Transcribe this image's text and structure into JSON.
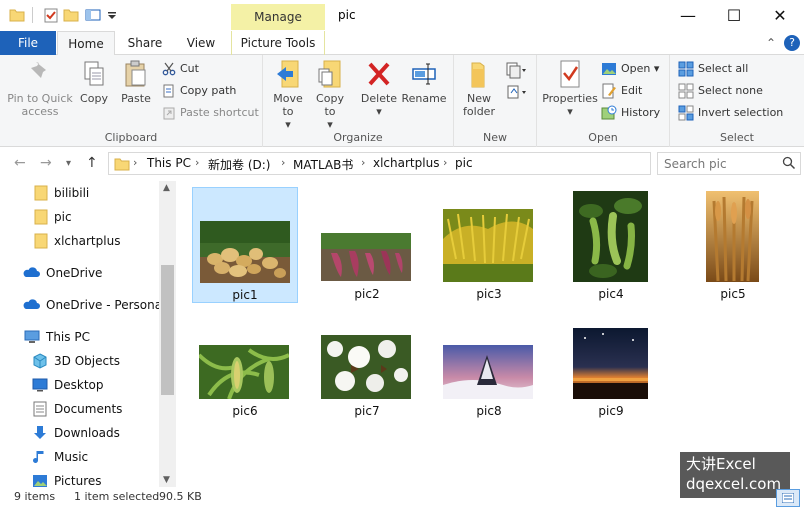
{
  "window": {
    "title": "pic",
    "context_tab": "Manage",
    "minimize": "—",
    "maximize": "☐",
    "close": "✕"
  },
  "tabs": {
    "file": "File",
    "home": "Home",
    "share": "Share",
    "view": "View",
    "picture_tools": "Picture Tools"
  },
  "ribbon": {
    "clipboard": {
      "label": "Clipboard",
      "pin": "Pin to Quick access",
      "copy": "Copy",
      "paste": "Paste",
      "cut": "Cut",
      "copy_path": "Copy path",
      "paste_shortcut": "Paste shortcut"
    },
    "organize": {
      "label": "Organize",
      "move_to": "Move to",
      "copy_to": "Copy to",
      "delete": "Delete",
      "rename": "Rename"
    },
    "new": {
      "label": "New",
      "new_folder": "New folder"
    },
    "open": {
      "label": "Open",
      "properties": "Properties",
      "open": "Open",
      "edit": "Edit",
      "history": "History"
    },
    "select": {
      "label": "Select",
      "select_all": "Select all",
      "select_none": "Select none",
      "invert": "Invert selection"
    }
  },
  "address": {
    "crumbs": [
      "This PC",
      "新加卷 (D:)",
      "MATLAB书",
      "xlchartplus",
      "pic"
    ],
    "search_placeholder": "Search pic"
  },
  "nav": {
    "items": [
      {
        "label": "bilibili",
        "icon": "folder-icon"
      },
      {
        "label": "pic",
        "icon": "folder-icon"
      },
      {
        "label": "xlchartplus",
        "icon": "folder-icon"
      },
      {
        "label": "OneDrive",
        "icon": "cloud-icon"
      },
      {
        "label": "OneDrive - Personal",
        "icon": "cloud-icon"
      },
      {
        "label": "This PC",
        "icon": "pc-icon"
      },
      {
        "label": "3D Objects",
        "icon": "cube-icon"
      },
      {
        "label": "Desktop",
        "icon": "desktop-icon"
      },
      {
        "label": "Documents",
        "icon": "document-icon"
      },
      {
        "label": "Downloads",
        "icon": "download-icon"
      },
      {
        "label": "Music",
        "icon": "music-icon"
      },
      {
        "label": "Pictures",
        "icon": "pictures-icon"
      }
    ]
  },
  "files": [
    {
      "name": "pic1",
      "selected": true
    },
    {
      "name": "pic2",
      "selected": false
    },
    {
      "name": "pic3",
      "selected": false
    },
    {
      "name": "pic4",
      "selected": false
    },
    {
      "name": "pic5",
      "selected": false
    },
    {
      "name": "pic6",
      "selected": false
    },
    {
      "name": "pic7",
      "selected": false
    },
    {
      "name": "pic8",
      "selected": false
    },
    {
      "name": "pic9",
      "selected": false
    }
  ],
  "status": {
    "count": "9 items",
    "selected": "1 item selected",
    "size": "90.5 KB"
  },
  "watermark": {
    "line1": "大讲Excel",
    "line2": "dqexcel.com"
  },
  "colors": {
    "accent": "#1e62b9",
    "selection": "#cce8ff",
    "manage_tab": "#f4f1a6",
    "folder": "#f8d775"
  }
}
